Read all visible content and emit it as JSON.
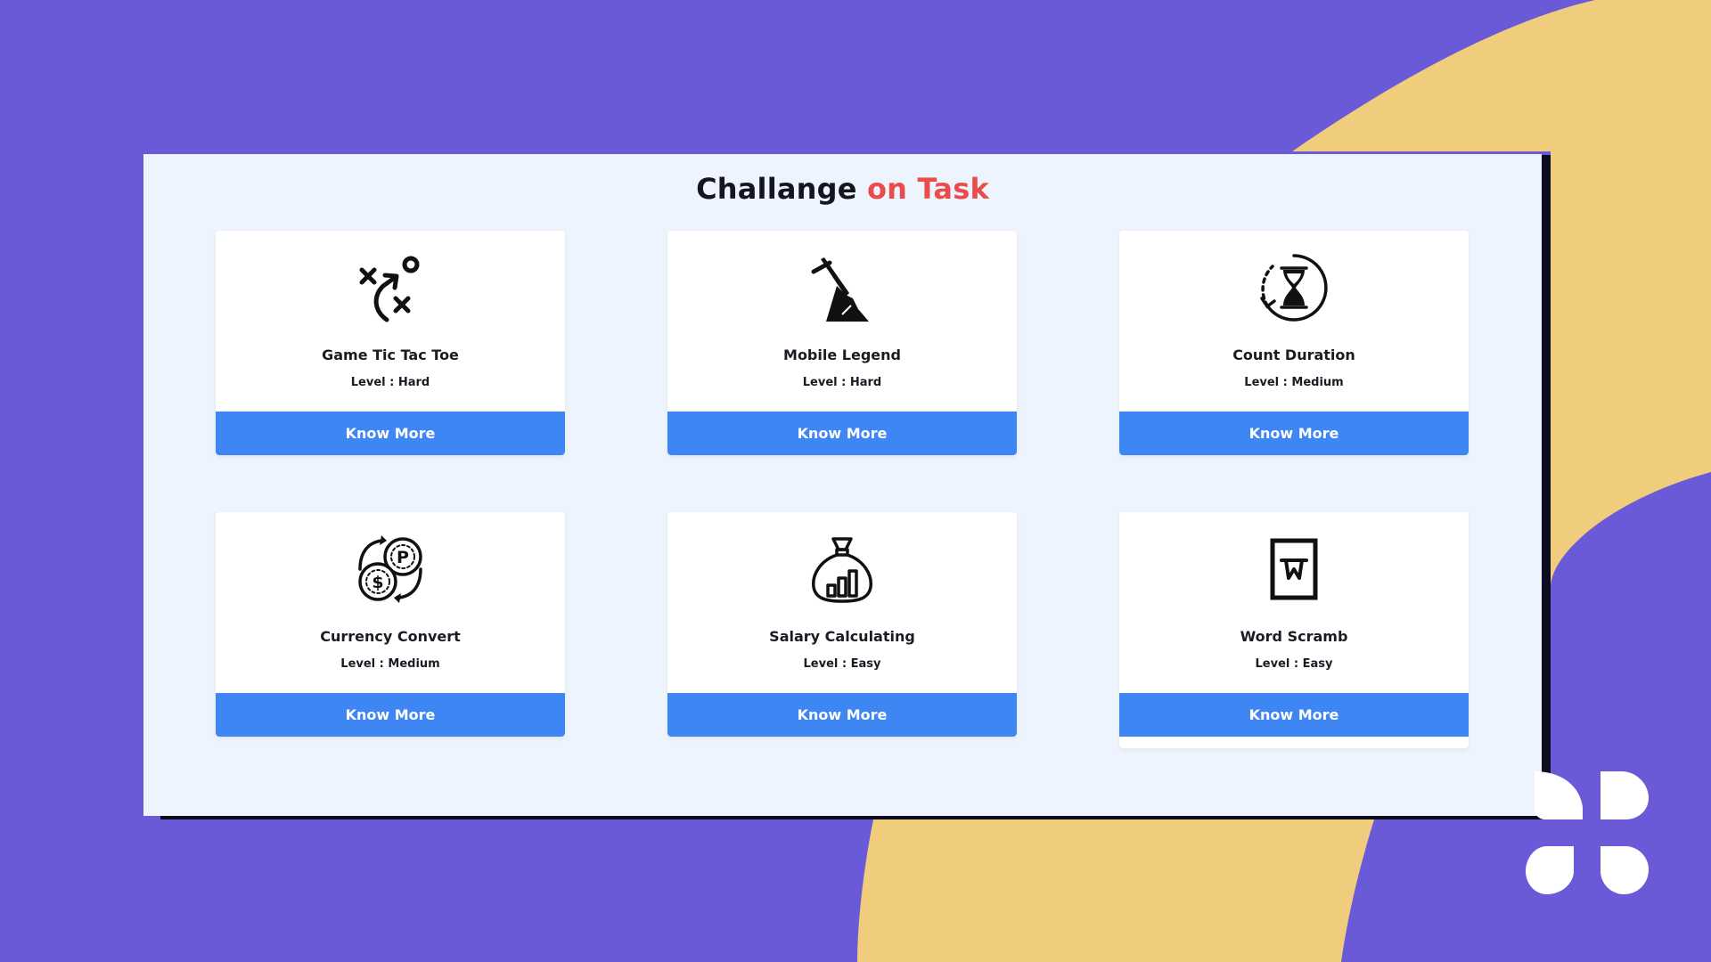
{
  "header": {
    "title_main": "Challange",
    "title_accent": "on Task"
  },
  "colors": {
    "background": "#6a5ad8",
    "blob": "#f0cd7c",
    "panel": "#eef4fd",
    "accent_text": "#ea4c4c",
    "button": "#3e86f3"
  },
  "cards": [
    {
      "name": "Game Tic Tac Toe",
      "level": "Level : Hard",
      "button_label": "Know More",
      "icon": "strategy-icon"
    },
    {
      "name": "Mobile Legend",
      "level": "Level : Hard",
      "button_label": "Know More",
      "icon": "sword-in-stone-icon"
    },
    {
      "name": "Count Duration",
      "level": "Level : Medium",
      "button_label": "Know More",
      "icon": "hourglass-icon"
    },
    {
      "name": "Currency Convert",
      "level": "Level : Medium",
      "button_label": "Know More",
      "icon": "currency-exchange-icon"
    },
    {
      "name": "Salary Calculating",
      "level": "Level : Easy",
      "button_label": "Know More",
      "icon": "money-bag-chart-icon"
    },
    {
      "name": "Word Scramb",
      "level": "Level : Easy",
      "button_label": "Know More",
      "icon": "word-document-icon"
    }
  ],
  "logo": {
    "icon": "clover-logo-icon"
  }
}
